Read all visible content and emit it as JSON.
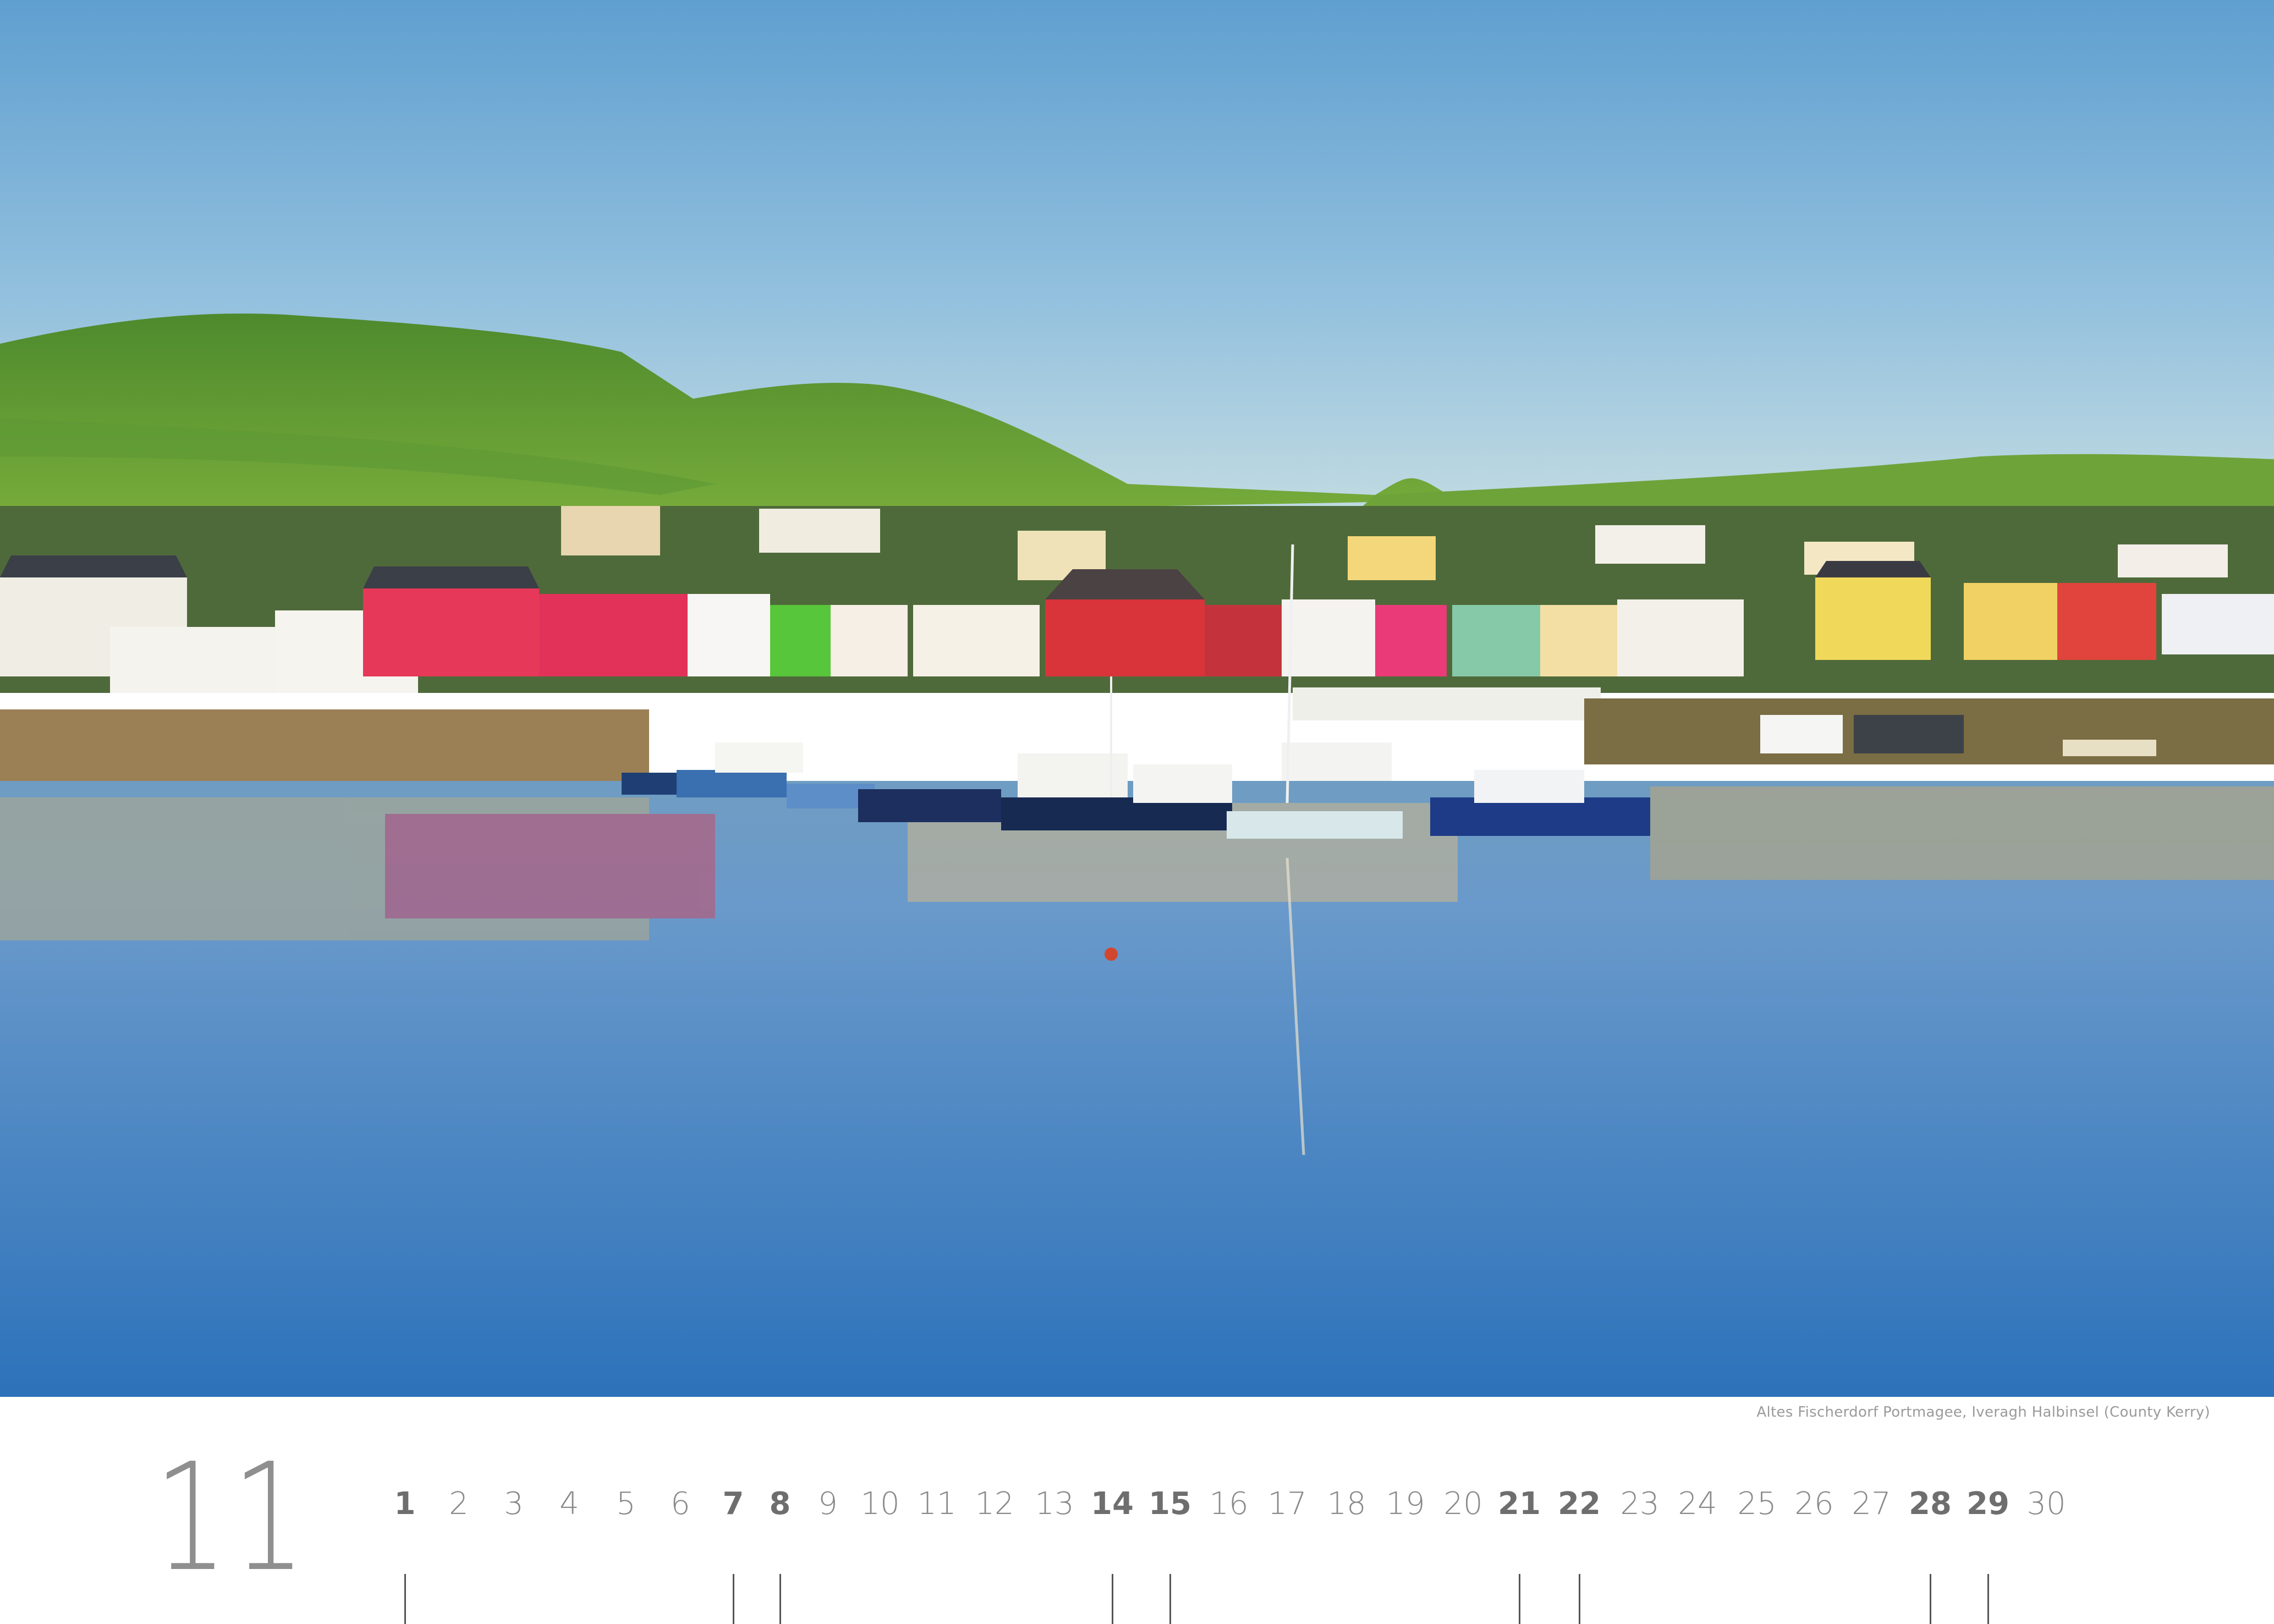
{
  "caption": "Altes Fischerdorf Portmagee, Iveragh Halbinsel (County Kerry)",
  "month_number": "11",
  "days": [
    {
      "label": "1",
      "bold": true
    },
    {
      "label": "2",
      "bold": false
    },
    {
      "label": "3",
      "bold": false
    },
    {
      "label": "4",
      "bold": false
    },
    {
      "label": "5",
      "bold": false
    },
    {
      "label": "6",
      "bold": false
    },
    {
      "label": "7",
      "bold": true
    },
    {
      "label": "8",
      "bold": true
    },
    {
      "label": "9",
      "bold": false
    },
    {
      "label": "10",
      "bold": false
    },
    {
      "label": "11",
      "bold": false
    },
    {
      "label": "12",
      "bold": false
    },
    {
      "label": "13",
      "bold": false
    },
    {
      "label": "14",
      "bold": true
    },
    {
      "label": "15",
      "bold": true
    },
    {
      "label": "16",
      "bold": false
    },
    {
      "label": "17",
      "bold": false
    },
    {
      "label": "18",
      "bold": false
    },
    {
      "label": "19",
      "bold": false
    },
    {
      "label": "20",
      "bold": false
    },
    {
      "label": "21",
      "bold": true
    },
    {
      "label": "22",
      "bold": true
    },
    {
      "label": "23",
      "bold": false
    },
    {
      "label": "24",
      "bold": false
    },
    {
      "label": "25",
      "bold": false
    },
    {
      "label": "26",
      "bold": false
    },
    {
      "label": "27",
      "bold": false
    },
    {
      "label": "28",
      "bold": true
    },
    {
      "label": "29",
      "bold": true
    },
    {
      "label": "30",
      "bold": false
    }
  ]
}
